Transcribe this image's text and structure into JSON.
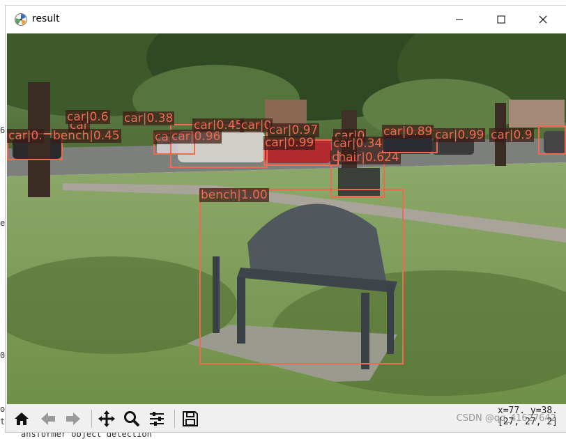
{
  "window": {
    "title": "result"
  },
  "background_console": {
    "left_fragments": [
      "6",
      "e",
      "0",
      "o",
      "t"
    ],
    "bottom_fragment": "ansformer object detection"
  },
  "detections": [
    {
      "label": "bench|1.00",
      "color": "#ee6a50"
    },
    {
      "label": "chair|0.624"
    },
    {
      "label": "bench|0.45"
    },
    {
      "label": "car|0."
    },
    {
      "label": "car|0.6"
    },
    {
      "label": "car|0.38"
    },
    {
      "label": "car|0.45"
    },
    {
      "label": "car|0.96"
    },
    {
      "label": "car|0.97"
    },
    {
      "label": "car|0.99"
    },
    {
      "label": "car|0.34"
    },
    {
      "label": "car|0.89"
    },
    {
      "label": "car|0.99"
    },
    {
      "label": "car|0.9"
    },
    {
      "label": "car"
    },
    {
      "label": "car|0"
    },
    {
      "label": "ca"
    },
    {
      "label": "car|0"
    }
  ],
  "toolbar": {
    "icons": [
      "home-icon",
      "back-arrow-icon",
      "forward-arrow-icon",
      "pan-icon",
      "zoom-icon",
      "configure-subplots-icon",
      "save-icon"
    ],
    "coords_line1": "x=77. y=38.",
    "coords_line2": "[27, 27, 2]",
    "watermark": "CSDN @qq_41627642"
  }
}
